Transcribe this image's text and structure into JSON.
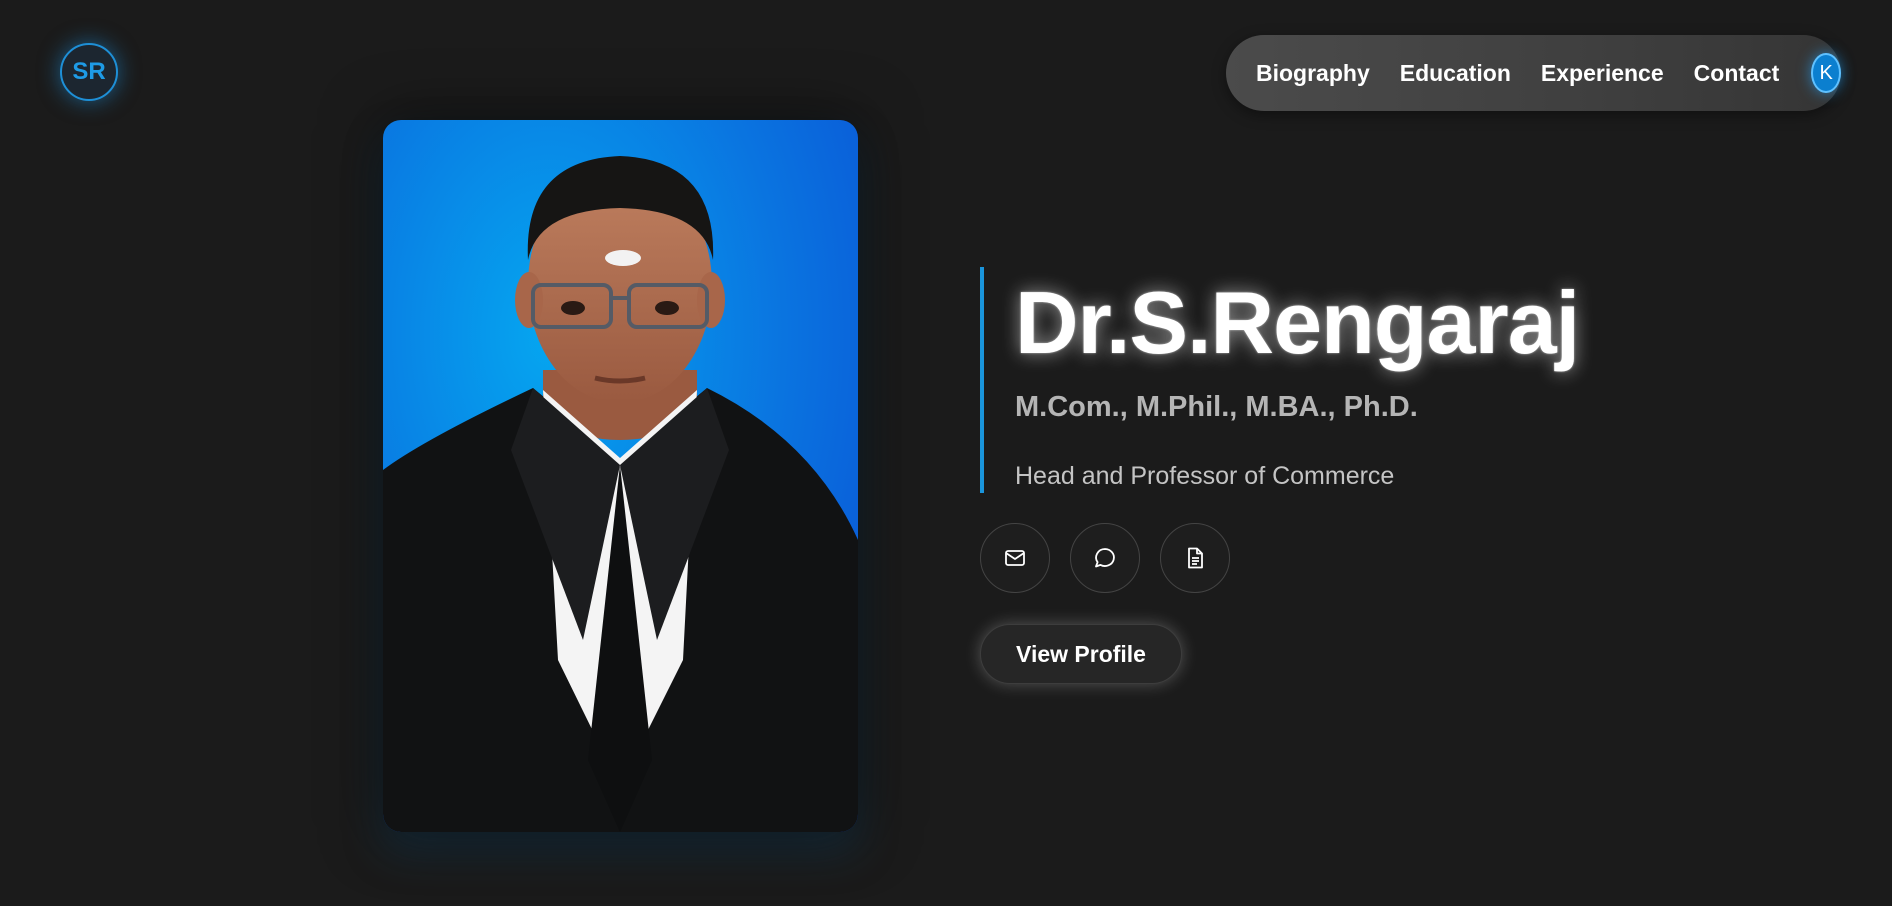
{
  "logo": {
    "initials": "SR"
  },
  "nav": {
    "items": [
      {
        "label": "Biography"
      },
      {
        "label": "Education"
      },
      {
        "label": "Experience"
      },
      {
        "label": "Contact"
      }
    ],
    "avatar_initial": "K"
  },
  "hero": {
    "name": "Dr.S.Rengaraj",
    "qualifications": "M.Com., M.Phil., M.BA., Ph.D.",
    "role": "Head and Professor of Commerce",
    "social_icons": [
      "mail-icon",
      "chat-icon",
      "document-icon"
    ],
    "cta_label": "View Profile"
  },
  "colors": {
    "accent": "#1a95dc",
    "background": "#1b1b1b",
    "nav_bg": "#444444"
  }
}
